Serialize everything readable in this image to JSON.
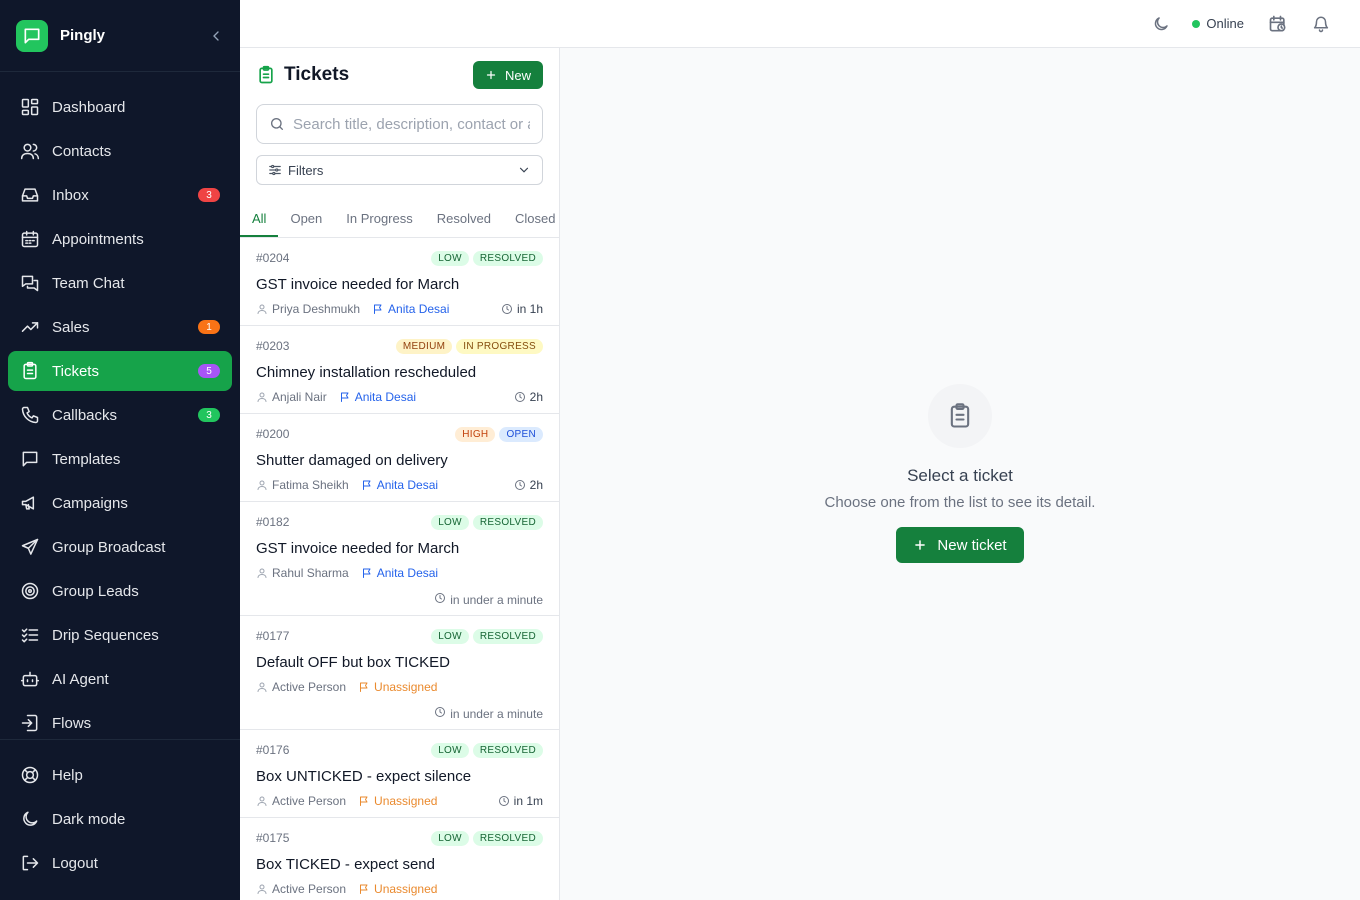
{
  "brand": {
    "name": "Pingly",
    "logo_icon": "chat-bubble-icon"
  },
  "nav": {
    "items": [
      {
        "label": "Dashboard",
        "icon": "dashboard-icon",
        "badge": ""
      },
      {
        "label": "Contacts",
        "icon": "users-icon",
        "badge": ""
      },
      {
        "label": "Inbox",
        "icon": "inbox-icon",
        "badge": "3",
        "badge_color": "#ef4444"
      },
      {
        "label": "Appointments",
        "icon": "calendar-icon",
        "badge": ""
      },
      {
        "label": "Team Chat",
        "icon": "messages-icon",
        "badge": ""
      },
      {
        "label": "Sales",
        "icon": "trending-up-icon",
        "badge": "1",
        "badge_color": "#f97316"
      },
      {
        "label": "Tickets",
        "icon": "clipboard-icon",
        "badge": "5",
        "badge_color": "#a855f7",
        "active": true
      },
      {
        "label": "Callbacks",
        "icon": "phone-icon",
        "badge": "3",
        "badge_color": "#22c55e"
      },
      {
        "label": "Templates",
        "icon": "message-square-icon",
        "badge": ""
      },
      {
        "label": "Campaigns",
        "icon": "megaphone-icon",
        "badge": ""
      },
      {
        "label": "Group Broadcast",
        "icon": "send-icon",
        "badge": ""
      },
      {
        "label": "Group Leads",
        "icon": "target-icon",
        "badge": ""
      },
      {
        "label": "Drip Sequences",
        "icon": "list-checks-icon",
        "badge": ""
      },
      {
        "label": "AI Agent",
        "icon": "bot-icon",
        "badge": ""
      },
      {
        "label": "Flows",
        "icon": "flow-icon",
        "badge": ""
      }
    ],
    "bottom": [
      {
        "label": "Help",
        "icon": "help-buoy-icon"
      },
      {
        "label": "Dark mode",
        "icon": "moon-icon"
      },
      {
        "label": "Logout",
        "icon": "logout-icon"
      }
    ]
  },
  "topbar": {
    "status": "Online",
    "status_color": "#22c55e"
  },
  "tickets": {
    "title": "Tickets",
    "new_label": "New",
    "search_placeholder": "Search title, description, contact or a",
    "filters_label": "Filters",
    "tabs": [
      "All",
      "Open",
      "In Progress",
      "Resolved",
      "Closed"
    ],
    "active_tab": "All",
    "list": [
      {
        "number": "#0204",
        "priority": "LOW",
        "status": "RESOLVED",
        "title": "GST invoice needed for March",
        "contact": "Priya Deshmukh",
        "assignee": "Anita Desai",
        "time": "in 1h",
        "time_on_own_line": false
      },
      {
        "number": "#0203",
        "priority": "MEDIUM",
        "status": "IN PROGRESS",
        "title": "Chimney installation rescheduled",
        "contact": "Anjali Nair",
        "assignee": "Anita Desai",
        "time": "2h",
        "time_on_own_line": false
      },
      {
        "number": "#0200",
        "priority": "HIGH",
        "status": "OPEN",
        "title": "Shutter damaged on delivery",
        "contact": "Fatima Sheikh",
        "assignee": "Anita Desai",
        "time": "2h",
        "time_on_own_line": false
      },
      {
        "number": "#0182",
        "priority": "LOW",
        "status": "RESOLVED",
        "title": "GST invoice needed for March",
        "contact": "Rahul Sharma",
        "assignee": "Anita Desai",
        "time": "in under a minute",
        "time_on_own_line": true
      },
      {
        "number": "#0177",
        "priority": "LOW",
        "status": "RESOLVED",
        "title": "Default OFF but box TICKED",
        "contact": "Active Person",
        "assignee": "Unassigned",
        "time": "in under a minute",
        "time_on_own_line": true
      },
      {
        "number": "#0176",
        "priority": "LOW",
        "status": "RESOLVED",
        "title": "Box UNTICKED - expect silence",
        "contact": "Active Person",
        "assignee": "Unassigned",
        "time": "in 1m",
        "time_on_own_line": false
      },
      {
        "number": "#0175",
        "priority": "LOW",
        "status": "RESOLVED",
        "title": "Box TICKED - expect send",
        "contact": "Active Person",
        "assignee": "Unassigned",
        "time": "",
        "time_on_own_line": false
      }
    ]
  },
  "detail": {
    "empty_title": "Select a ticket",
    "empty_subtitle": "Choose one from the list to see its detail.",
    "new_ticket_label": "New ticket"
  },
  "colors": {
    "accent": "#15803d",
    "sidebar_bg": "#0f172a",
    "assigned": "#2563eb",
    "unassigned": "#ea8a2e"
  }
}
